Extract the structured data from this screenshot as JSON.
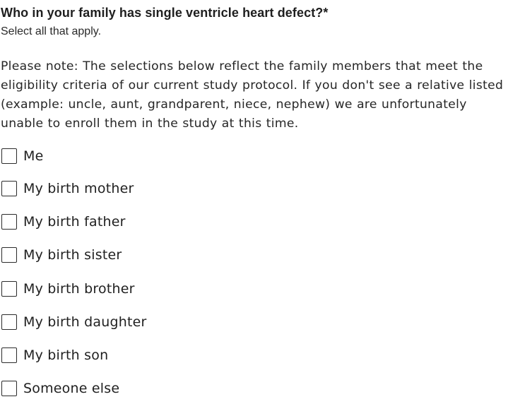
{
  "question": {
    "title": "Who in your family has single ventricle heart defect?",
    "required_marker": "*",
    "hint": "Select all that apply.",
    "note_lines": [
      "Please note: The selections below reflect the family members that meet the",
      "eligibility criteria of our current study protocol. If you don't see a relative listed",
      "(example: uncle, aunt, grandparent, niece, nephew) we are unfortunately",
      "unable to enroll them in the study at this time."
    ]
  },
  "options": [
    {
      "label": "Me",
      "checked": false
    },
    {
      "label": "My birth mother",
      "checked": false
    },
    {
      "label": "My birth father",
      "checked": false
    },
    {
      "label": "My birth sister",
      "checked": false
    },
    {
      "label": "My birth brother",
      "checked": false
    },
    {
      "label": "My birth daughter",
      "checked": false
    },
    {
      "label": "My birth son",
      "checked": false
    },
    {
      "label": "Someone else",
      "checked": false
    }
  ]
}
